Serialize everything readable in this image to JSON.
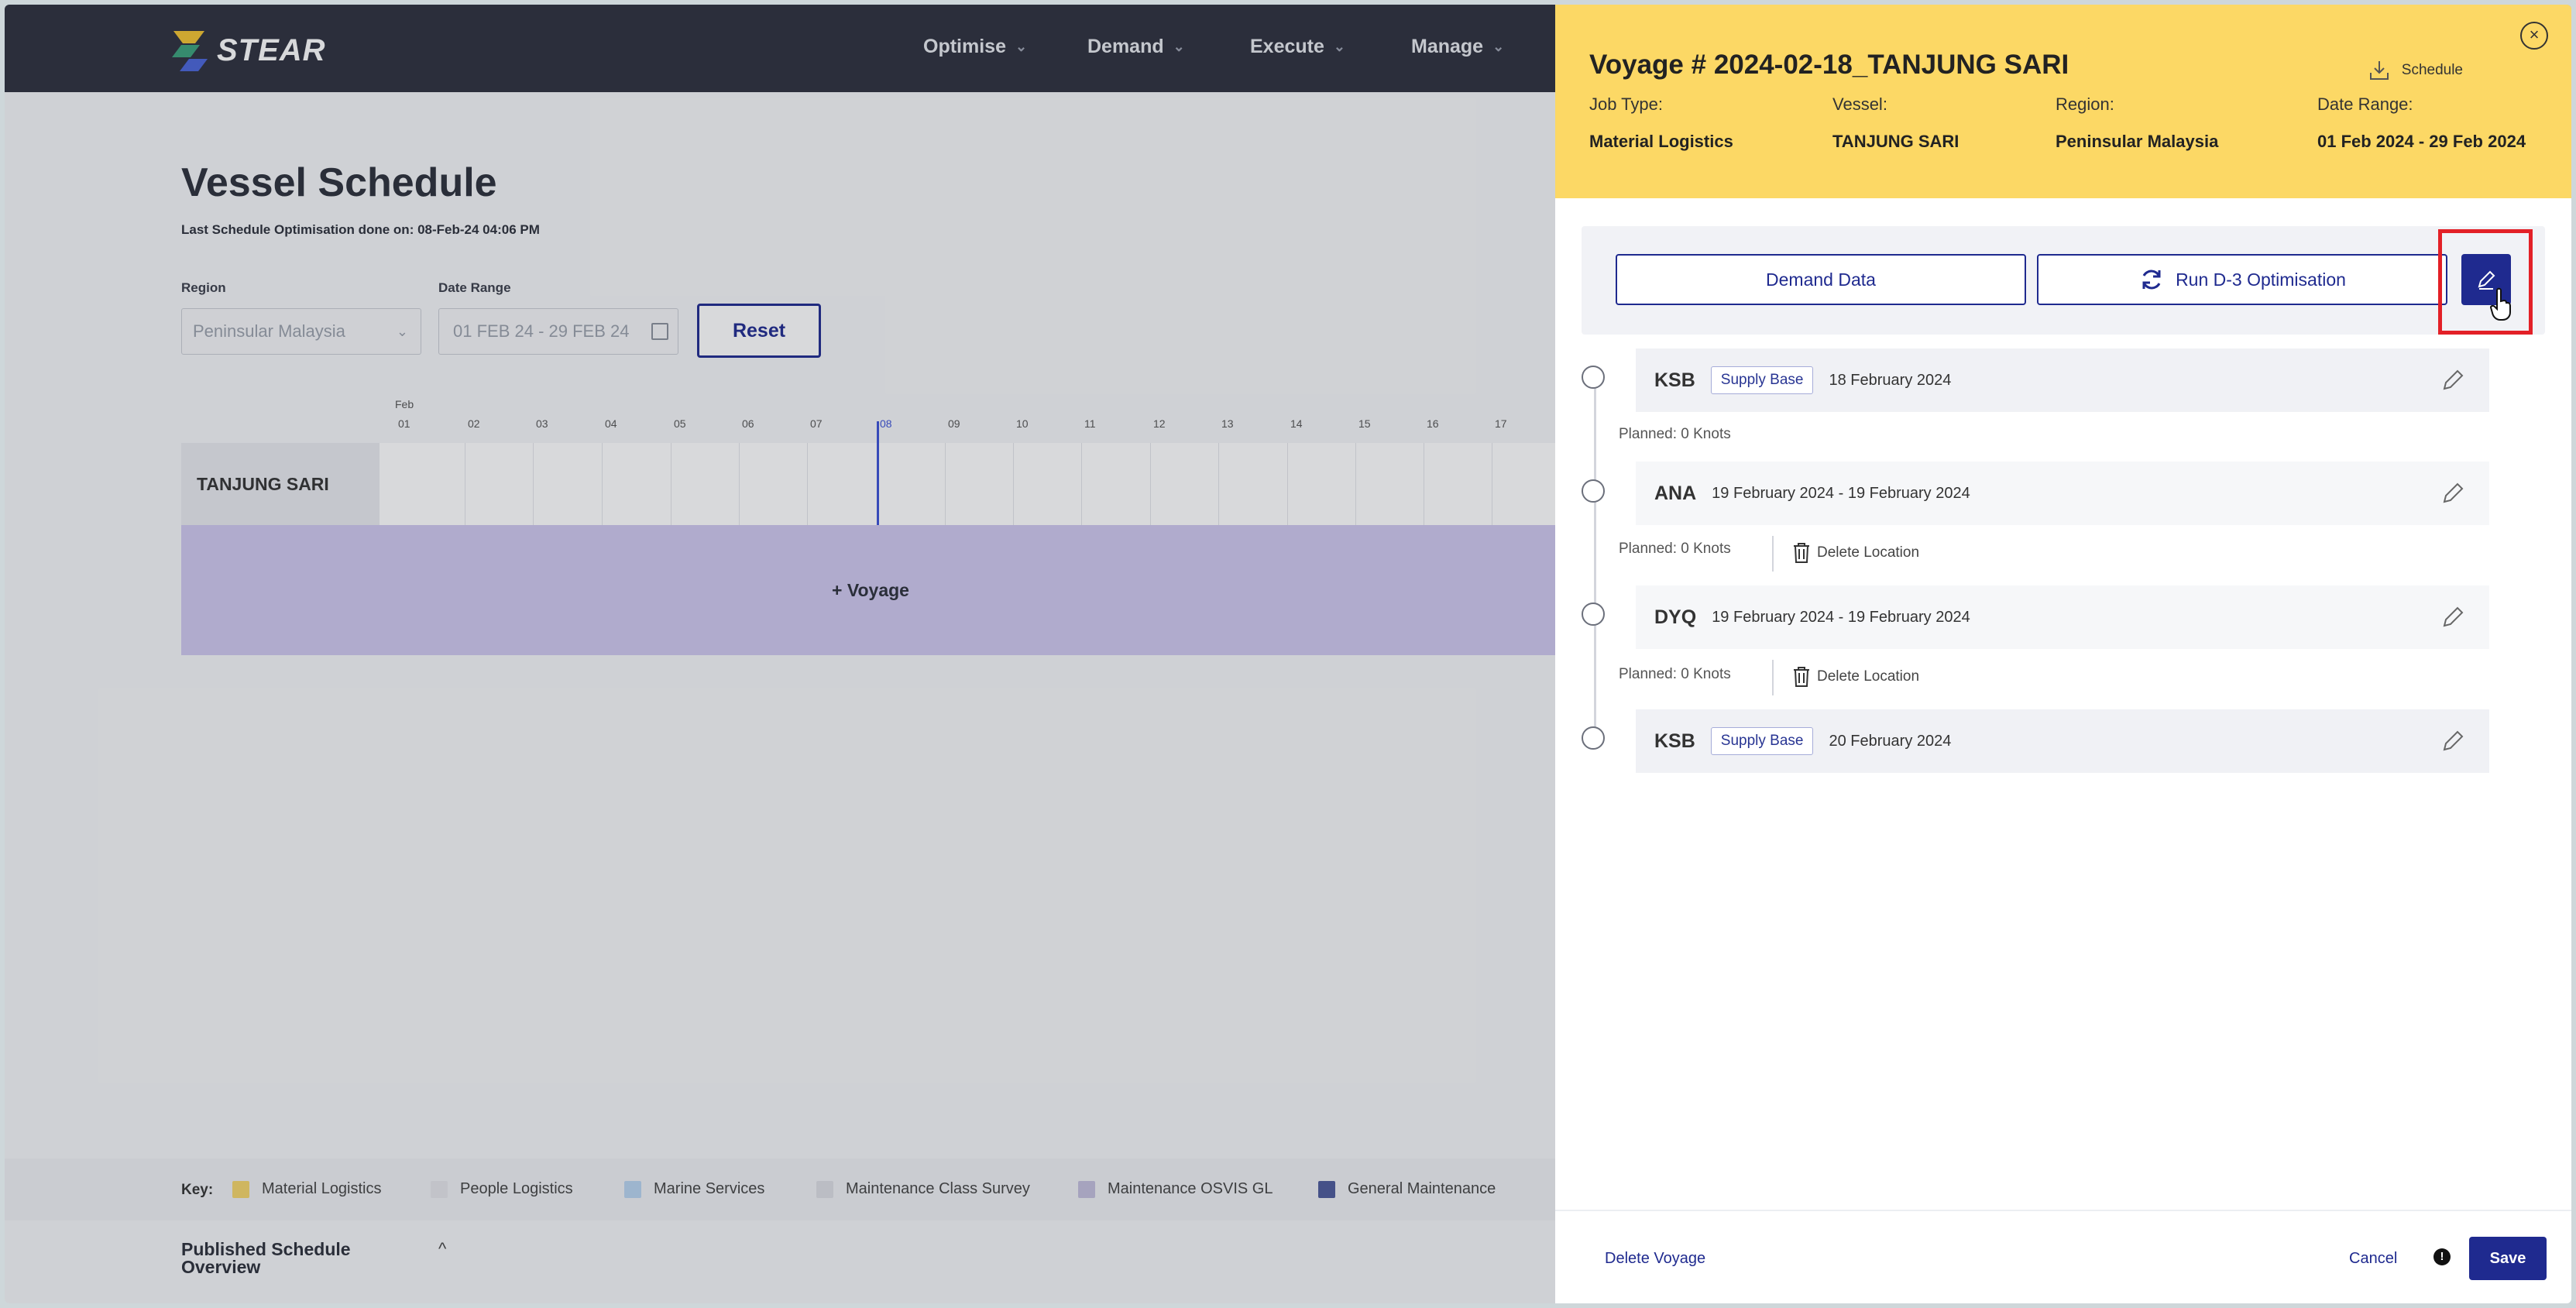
{
  "app": {
    "logo_text": "STEAR"
  },
  "nav": [
    {
      "label": "Optimise"
    },
    {
      "label": "Demand"
    },
    {
      "label": "Execute"
    },
    {
      "label": "Manage"
    }
  ],
  "page": {
    "title": "Vessel Schedule",
    "subtitle": "Last Schedule Optimisation done on: 08-Feb-24 04:06 PM",
    "region_label": "Region",
    "region_value": "Peninsular Malaysia",
    "date_range_label": "Date Range",
    "date_range_value": "01 FEB 24 - 29 FEB 24",
    "reset_label": "Reset"
  },
  "timeline": {
    "month": "Feb",
    "days": [
      "01",
      "02",
      "03",
      "04",
      "05",
      "06",
      "07",
      "08",
      "09",
      "10",
      "11",
      "12",
      "13",
      "14",
      "15",
      "16",
      "17"
    ],
    "today": "08",
    "vessel": "TANJUNG SARI",
    "add_voyage_label": "Voyage"
  },
  "key": {
    "label": "Key:",
    "items": [
      {
        "label": "Material Logistics",
        "color": "#f5d56a"
      },
      {
        "label": "People Logistics",
        "color": "#e4e5ea"
      },
      {
        "label": "Marine Services",
        "color": "#b8d3f0"
      },
      {
        "label": "Maintenance Class Survey",
        "color": "#dcdde3"
      },
      {
        "label": "Maintenance OSVIS GL",
        "color": "#c2bddc"
      },
      {
        "label": "General Maintenance",
        "color": "#4c5a9a"
      }
    ]
  },
  "published": {
    "label": "Published Schedule Overview"
  },
  "panel": {
    "title": "Voyage # 2024-02-18_TANJUNG SARI",
    "schedule_label": "Schedule",
    "meta": [
      {
        "label": "Job Type:",
        "value": "Material Logistics"
      },
      {
        "label": "Vessel:",
        "value": "TANJUNG SARI"
      },
      {
        "label": "Region:",
        "value": "Peninsular Malaysia"
      },
      {
        "label": "Date Range:",
        "value": "01 Feb 2024 - 29 Feb 2024"
      }
    ],
    "demand_data_label": "Demand Data",
    "run_optimisation_label": "Run D-3 Optimisation",
    "stops": [
      {
        "code": "KSB",
        "badge": "Supply Base",
        "date": "18 February 2024",
        "planned": "Planned: 0 Knots",
        "delete": ""
      },
      {
        "code": "ANA",
        "badge": "",
        "date": "19 February 2024 - 19 February 2024",
        "planned": "Planned: 0 Knots",
        "delete": "Delete Location"
      },
      {
        "code": "DYQ",
        "badge": "",
        "date": "19 February 2024 - 19 February 2024",
        "planned": "Planned: 0 Knots",
        "delete": "Delete Location"
      },
      {
        "code": "KSB",
        "badge": "Supply Base",
        "date": "20 February 2024",
        "planned": "",
        "delete": ""
      }
    ],
    "delete_voyage_label": "Delete Voyage",
    "cancel_label": "Cancel",
    "save_label": "Save"
  }
}
